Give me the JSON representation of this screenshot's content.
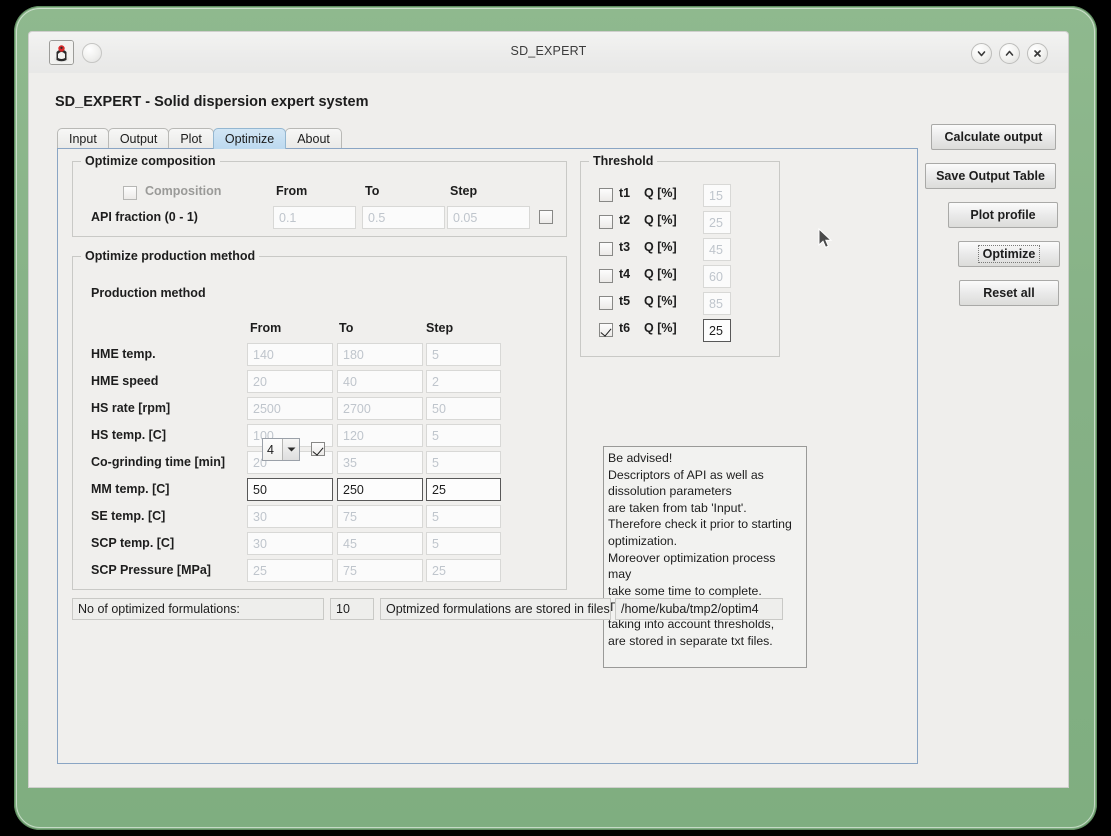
{
  "window": {
    "title": "SD_EXPERT",
    "app_icon": "java-duke-icon",
    "controls": {
      "minimize": "chevron-down-icon",
      "maximize": "chevron-up-icon",
      "close": "close-icon"
    }
  },
  "app": {
    "heading": "SD_EXPERT - Solid dispersion expert system"
  },
  "tabs": [
    {
      "label": "Input",
      "selected": false
    },
    {
      "label": "Output",
      "selected": false
    },
    {
      "label": "Plot",
      "selected": false
    },
    {
      "label": "Optimize",
      "selected": true
    },
    {
      "label": "About",
      "selected": false
    }
  ],
  "optimize_composition": {
    "title": "Optimize composition",
    "checkbox_label": "Composition",
    "checkbox_checked": false,
    "columns": [
      "From",
      "To",
      "Step"
    ],
    "row": {
      "label": "API fraction (0 - 1)",
      "from": "0.1",
      "to": "0.5",
      "step": "0.05",
      "enabled": false,
      "trailing_checkbox_checked": false
    }
  },
  "optimize_production": {
    "title": "Optimize production method",
    "method_label": "Production method",
    "method_value": "4",
    "method_checkbox_checked": true,
    "columns": [
      "From",
      "To",
      "Step"
    ],
    "rows": [
      {
        "label": "HME temp.",
        "from": "140",
        "to": "180",
        "step": "5",
        "enabled": false
      },
      {
        "label": "HME speed",
        "from": "20",
        "to": "40",
        "step": "2",
        "enabled": false
      },
      {
        "label": "HS rate [rpm]",
        "from": "2500",
        "to": "2700",
        "step": "50",
        "enabled": false
      },
      {
        "label": "HS temp. [C]",
        "from": "100",
        "to": "120",
        "step": "5",
        "enabled": false
      },
      {
        "label": "Co-grinding time [min]",
        "from": "20",
        "to": "35",
        "step": "5",
        "enabled": false
      },
      {
        "label": "MM temp. [C]",
        "from": "50",
        "to": "250",
        "step": "25",
        "enabled": true
      },
      {
        "label": "SE temp. [C]",
        "from": "30",
        "to": "75",
        "step": "5",
        "enabled": false
      },
      {
        "label": "SCP temp. [C]",
        "from": "30",
        "to": "45",
        "step": "5",
        "enabled": false
      },
      {
        "label": "SCP Pressure [MPa]",
        "from": "25",
        "to": "75",
        "step": "25",
        "enabled": false
      }
    ]
  },
  "threshold": {
    "title": "Threshold",
    "unit_label": "Q [%]",
    "rows": [
      {
        "name": "t1",
        "value": "15",
        "checked": false
      },
      {
        "name": "t2",
        "value": "25",
        "checked": false
      },
      {
        "name": "t3",
        "value": "45",
        "checked": false
      },
      {
        "name": "t4",
        "value": "60",
        "checked": false
      },
      {
        "name": "t5",
        "value": "85",
        "checked": false
      },
      {
        "name": "t6",
        "value": "25",
        "checked": true
      }
    ]
  },
  "advisory": {
    "text": "Be advised!\nDescriptors of API as well as\ndissolution parameters\nare taken from tab 'Input'.\nTherefore check it prior to starting\noptimization.\nMoreover optimization process may\ntake some time to complete.\nThe resulting formulations,\ntaking into account thresholds,\nare stored in separate txt files."
  },
  "status": {
    "count_label": "No of optimized formulations:",
    "count_value": "10",
    "files_label": "Optmized formulations are stored in files:",
    "files_value": "/home/kuba/tmp2/optim4"
  },
  "side_buttons": [
    {
      "label": "Calculate output",
      "focused": false
    },
    {
      "label": "Save Output Table",
      "focused": false
    },
    {
      "label": "Plot profile",
      "focused": false
    },
    {
      "label": "Optimize",
      "focused": true
    },
    {
      "label": "Reset all",
      "focused": false
    }
  ],
  "colors": {
    "frame_green": "#86b186",
    "panel_bg": "#f0efed",
    "tab_selected": "#c6dff0",
    "panel_border_blue": "#8aa5c4",
    "disabled_text": "#bfc5cc"
  }
}
